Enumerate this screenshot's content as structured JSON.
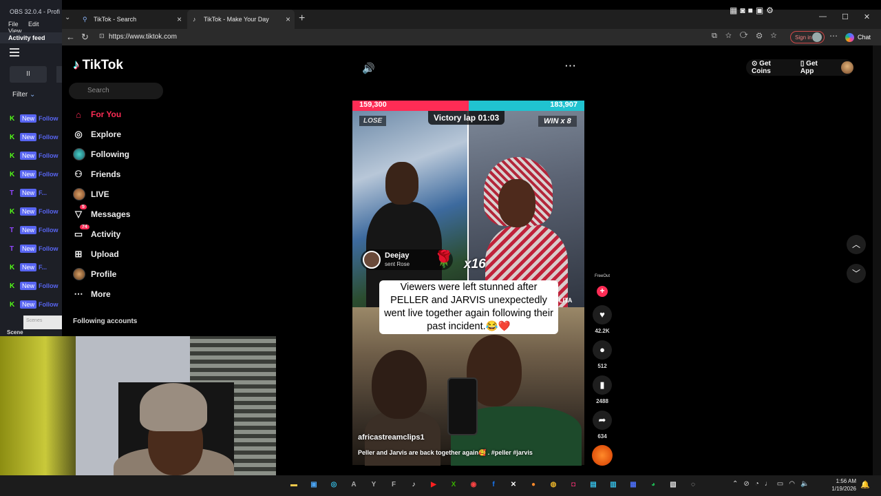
{
  "obs": {
    "title": "OBS 32.0.4 - Profi",
    "menu": [
      "File",
      "Edit",
      "View"
    ],
    "activity_label": "Activity feed",
    "pause_glyph": "II",
    "filter_label": "Filter",
    "events": [
      {
        "src": "K",
        "src_color": "#53fc18",
        "badge": "New",
        "text": "Follow"
      },
      {
        "src": "K",
        "src_color": "#53fc18",
        "badge": "New",
        "text": "Follow"
      },
      {
        "src": "K",
        "src_color": "#53fc18",
        "badge": "New",
        "text": "Follow"
      },
      {
        "src": "K",
        "src_color": "#53fc18",
        "badge": "New",
        "text": "Follow"
      },
      {
        "src": "T",
        "src_color": "#9146ff",
        "badge": "New",
        "text": "F..."
      },
      {
        "src": "K",
        "src_color": "#53fc18",
        "badge": "New",
        "text": "Follow"
      },
      {
        "src": "T",
        "src_color": "#9146ff",
        "badge": "New",
        "text": "Follow"
      },
      {
        "src": "T",
        "src_color": "#9146ff",
        "badge": "New",
        "text": "Follow"
      },
      {
        "src": "K",
        "src_color": "#53fc18",
        "badge": "New",
        "text": "F..."
      },
      {
        "src": "K",
        "src_color": "#53fc18",
        "badge": "New",
        "text": "Follow"
      },
      {
        "src": "K",
        "src_color": "#53fc18",
        "badge": "New",
        "text": "Follow"
      }
    ],
    "scenes_label": "Scenes",
    "scenes_bar": "Scene"
  },
  "browser": {
    "tabs": [
      {
        "label": "TikTok - Search",
        "icon": "search-icon",
        "active": false
      },
      {
        "label": "TikTok - Make Your Day",
        "icon": "tiktok-icon",
        "active": true
      }
    ],
    "url": "https://www.tiktok.com",
    "sign_in_label": "Sign in",
    "chat_label": "Chat"
  },
  "tiktok": {
    "logo_text": "TikTok",
    "search_placeholder": "Search",
    "nav": [
      {
        "label": "For You",
        "icon": "home-icon"
      },
      {
        "label": "Explore",
        "icon": "compass-icon"
      },
      {
        "label": "Following",
        "icon": "following-avatar-icon"
      },
      {
        "label": "Friends",
        "icon": "friends-icon"
      },
      {
        "label": "LIVE",
        "icon": "live-avatar-icon"
      },
      {
        "label": "Messages",
        "icon": "messages-icon",
        "badge": "5"
      },
      {
        "label": "Activity",
        "icon": "activity-icon",
        "badge": "74"
      },
      {
        "label": "Upload",
        "icon": "upload-icon"
      },
      {
        "label": "Profile",
        "icon": "profile-avatar-icon"
      },
      {
        "label": "More",
        "icon": "more-icon"
      }
    ],
    "following_accounts_label": "Following accounts",
    "get_coins": "Get Coins",
    "get_app": "Get App",
    "accent": "#fe2c55"
  },
  "video": {
    "pk_left_score": "159,300",
    "pk_right_score": "183,907",
    "lose_label": "LOSE",
    "win_label": "WIN x 8",
    "victory_label": "Victory lap 01:03",
    "gift_user": "Deejay",
    "gift_action": "sent Rose",
    "gift_multiplier": "x16",
    "right_name_partial": "LITA",
    "caption": "Viewers were left stunned after PELLER and JARVIS unexpectedly went live together again following their past incident.😂❤️",
    "author": "africastreamclips1",
    "description": "Peller and Jarvis are back together again🥰 . #peller #jarvis",
    "creator_tag": "FreeOut"
  },
  "actions": {
    "likes": "42.2K",
    "comments": "512",
    "saves": "2488",
    "shares": "634"
  },
  "taskbar": {
    "time": "1:56 AM",
    "date": "1/19/2026",
    "apps": [
      {
        "name": "folder",
        "glyph": "▬",
        "color": "#f2c94c"
      },
      {
        "name": "store",
        "glyph": "▣",
        "color": "#4aa3f0"
      },
      {
        "name": "edge",
        "glyph": "◎",
        "color": "#36c0e8"
      },
      {
        "name": "a-app",
        "glyph": "A",
        "color": "#aaaaaa"
      },
      {
        "name": "y-app",
        "glyph": "Y",
        "color": "#aaaaaa"
      },
      {
        "name": "f-app",
        "glyph": "F",
        "color": "#aaaaaa"
      },
      {
        "name": "tiktok",
        "glyph": "♪",
        "color": "#ffffff"
      },
      {
        "name": "youtube",
        "glyph": "▶",
        "color": "#ff2020"
      },
      {
        "name": "xbox",
        "glyph": "X",
        "color": "#38b000"
      },
      {
        "name": "discord",
        "glyph": "◉",
        "color": "#ff4444"
      },
      {
        "name": "facebook",
        "glyph": "f",
        "color": "#1877f2"
      },
      {
        "name": "x",
        "glyph": "✕",
        "color": "#ffffff"
      },
      {
        "name": "chrome-alt",
        "glyph": "●",
        "color": "#ff8a2a"
      },
      {
        "name": "chrome",
        "glyph": "◍",
        "color": "#e8b32a"
      },
      {
        "name": "instagram",
        "glyph": "◘",
        "color": "#e1306c"
      },
      {
        "name": "photos",
        "glyph": "▤",
        "color": "#36c0e8"
      },
      {
        "name": "app-blue",
        "glyph": "▥",
        "color": "#36c0e8"
      },
      {
        "name": "calendar",
        "glyph": "▦",
        "color": "#4a6cf0"
      },
      {
        "name": "spotify",
        "glyph": "◕",
        "color": "#1db954"
      },
      {
        "name": "app-white",
        "glyph": "▧",
        "color": "#dddddd"
      },
      {
        "name": "obs",
        "glyph": "◌",
        "color": "#dddddd"
      }
    ]
  }
}
